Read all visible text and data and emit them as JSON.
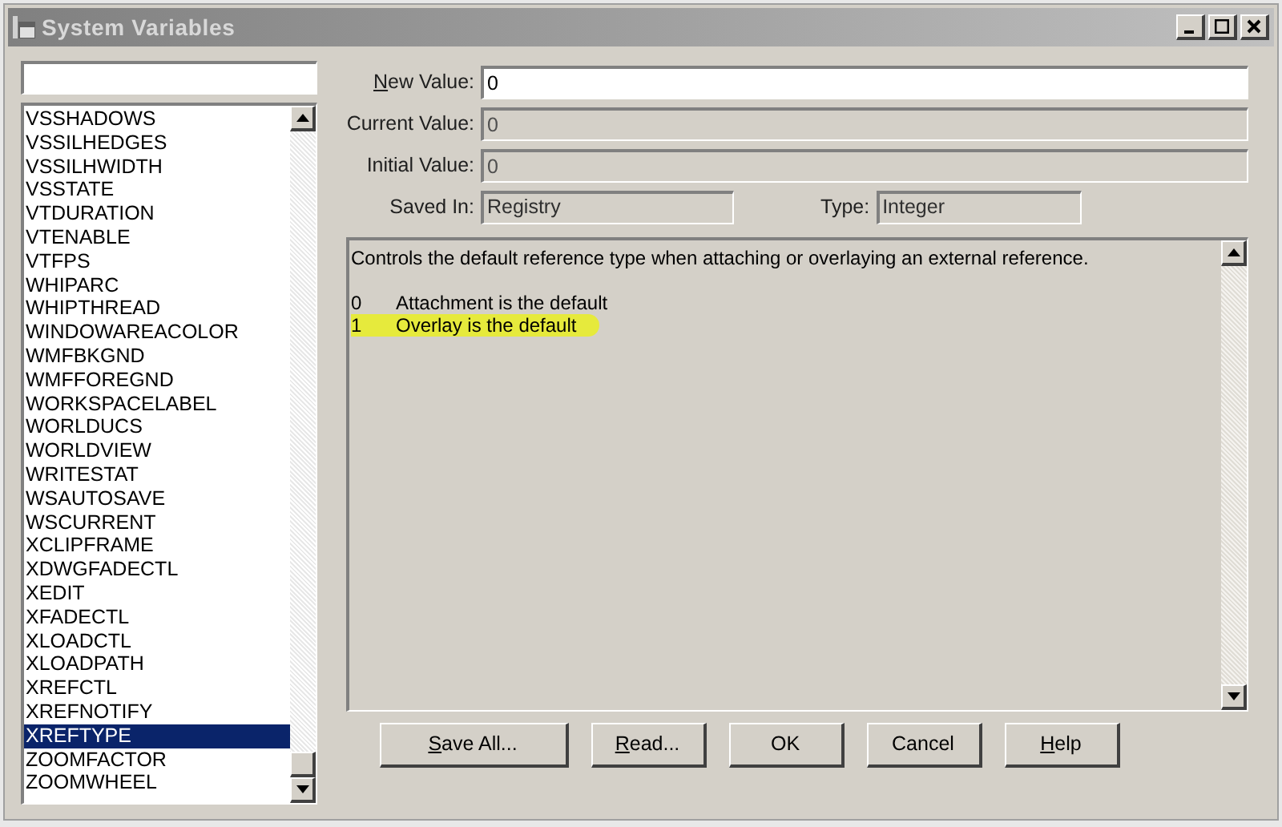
{
  "window": {
    "title": "System Variables"
  },
  "variables": [
    {
      "name": "VSSHADOWS",
      "selected": false
    },
    {
      "name": "VSSILHEDGES",
      "selected": false
    },
    {
      "name": "VSSILHWIDTH",
      "selected": false
    },
    {
      "name": "VSSTATE",
      "selected": false
    },
    {
      "name": "VTDURATION",
      "selected": false
    },
    {
      "name": "VTENABLE",
      "selected": false
    },
    {
      "name": "VTFPS",
      "selected": false
    },
    {
      "name": "WHIPARC",
      "selected": false
    },
    {
      "name": "WHIPTHREAD",
      "selected": false
    },
    {
      "name": "WINDOWAREACOLOR",
      "selected": false
    },
    {
      "name": "WMFBKGND",
      "selected": false
    },
    {
      "name": "WMFFOREGND",
      "selected": false
    },
    {
      "name": "WORKSPACELABEL",
      "selected": false
    },
    {
      "name": "WORLDUCS",
      "selected": false
    },
    {
      "name": "WORLDVIEW",
      "selected": false
    },
    {
      "name": "WRITESTAT",
      "selected": false
    },
    {
      "name": "WSAUTOSAVE",
      "selected": false
    },
    {
      "name": "WSCURRENT",
      "selected": false
    },
    {
      "name": "XCLIPFRAME",
      "selected": false
    },
    {
      "name": "XDWGFADECTL",
      "selected": false
    },
    {
      "name": "XEDIT",
      "selected": false
    },
    {
      "name": "XFADECTL",
      "selected": false
    },
    {
      "name": "XLOADCTL",
      "selected": false
    },
    {
      "name": "XLOADPATH",
      "selected": false
    },
    {
      "name": "XREFCTL",
      "selected": false
    },
    {
      "name": "XREFNOTIFY",
      "selected": false
    },
    {
      "name": "XREFTYPE",
      "selected": true
    },
    {
      "name": "ZOOMFACTOR",
      "selected": false
    },
    {
      "name": "ZOOMWHEEL",
      "selected": false
    }
  ],
  "fields": [
    {
      "label": "New Value:",
      "mnemonic": true,
      "value": "0",
      "disabled": false
    },
    {
      "label": "Current Value:",
      "mnemonic": false,
      "value": "0",
      "disabled": true
    },
    {
      "label": "Initial Value:",
      "mnemonic": false,
      "value": "0",
      "disabled": true
    }
  ],
  "saved_in": {
    "label": "Saved In:",
    "value": "Registry"
  },
  "type": {
    "label": "Type:",
    "value": "Integer"
  },
  "description": {
    "text": "Controls the default reference type when attaching or overlaying an external reference.",
    "options": [
      {
        "code": "0",
        "text": "Attachment is the default",
        "highlighted": false
      },
      {
        "code": "1",
        "text": "Overlay is the default",
        "highlighted": true
      }
    ]
  },
  "buttons": [
    {
      "label": "Save All...",
      "mnemonic": true
    },
    {
      "label": "Read...",
      "mnemonic": true
    },
    {
      "label": "OK",
      "mnemonic": false
    },
    {
      "label": "Cancel",
      "mnemonic": false
    },
    {
      "label": "Help",
      "mnemonic": true
    }
  ]
}
